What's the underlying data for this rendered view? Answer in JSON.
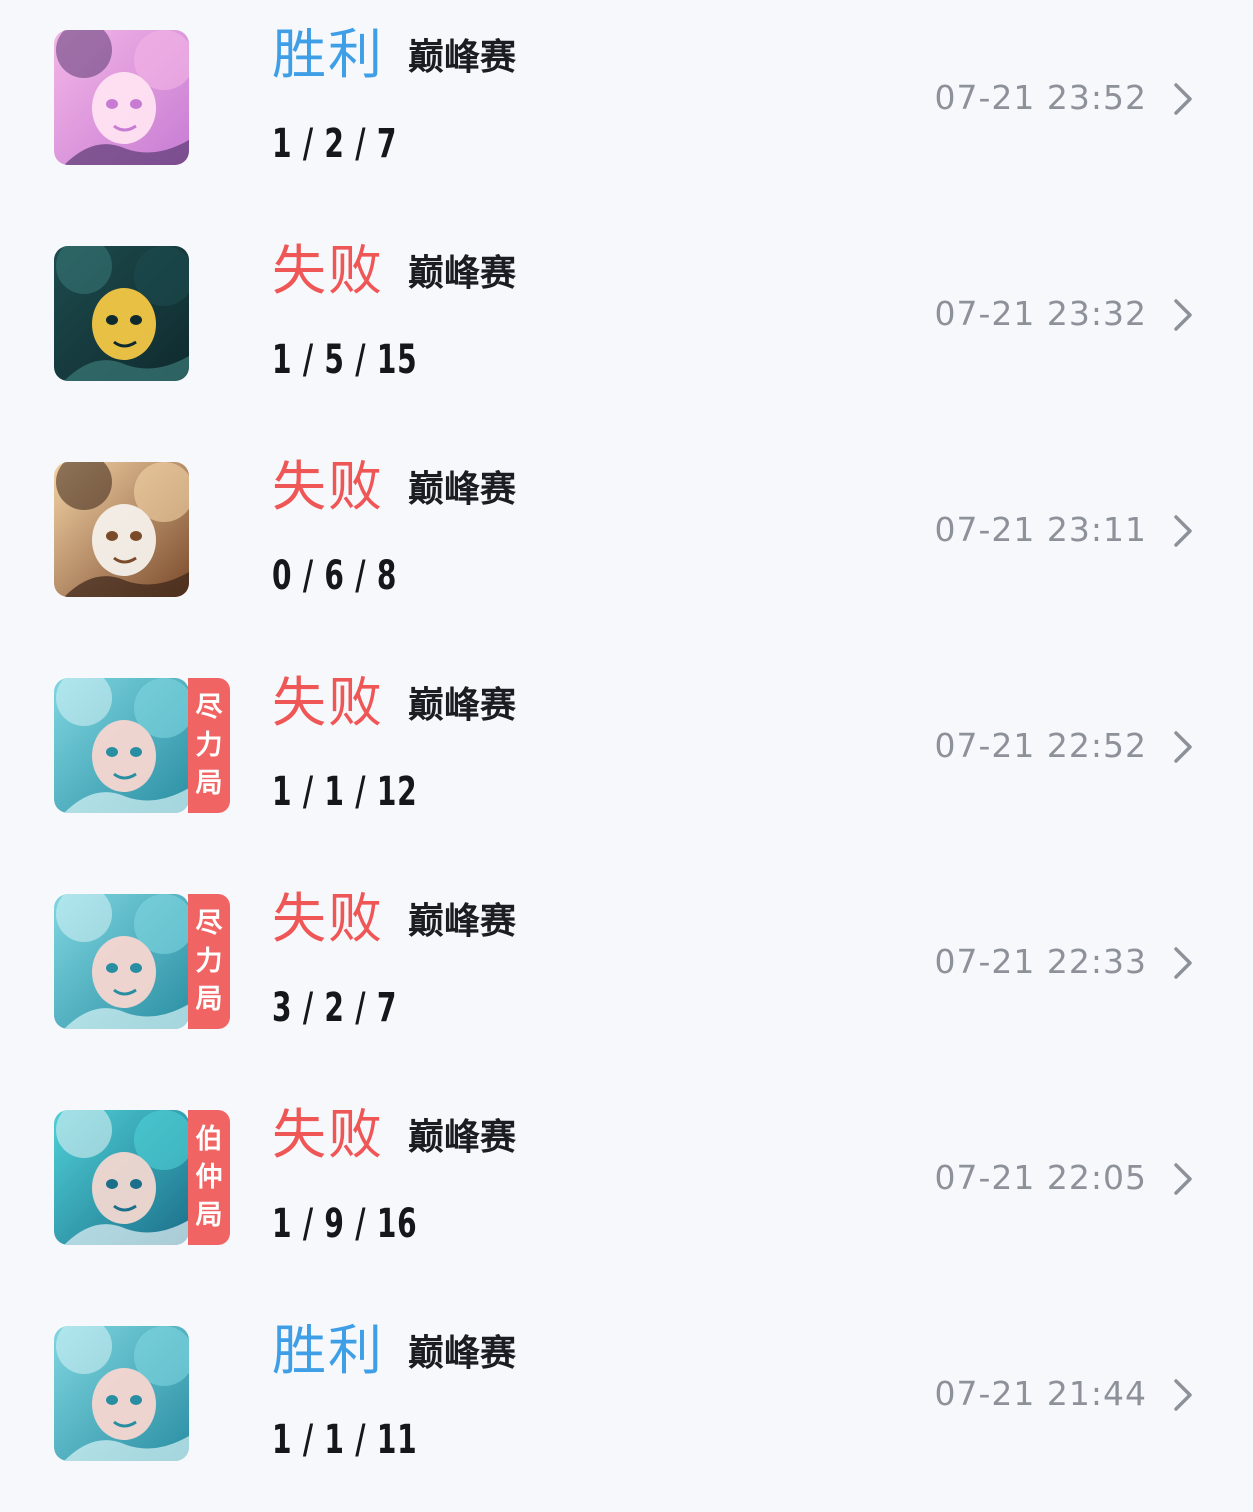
{
  "matches": [
    {
      "result": "胜利",
      "result_type": "win",
      "mode": "巅峰赛",
      "kda": "1 / 2 / 7",
      "time": "07-21 23:52",
      "badge": [],
      "hero_palette": "pink"
    },
    {
      "result": "失败",
      "result_type": "lose",
      "mode": "巅峰赛",
      "kda": "1 / 5 / 15",
      "time": "07-21 23:32",
      "badge": [],
      "hero_palette": "dark-teal"
    },
    {
      "result": "失败",
      "result_type": "lose",
      "mode": "巅峰赛",
      "kda": "0 / 6 / 8",
      "time": "07-21 23:11",
      "badge": [],
      "hero_palette": "warm"
    },
    {
      "result": "失败",
      "result_type": "lose",
      "mode": "巅峰赛",
      "kda": "1 / 1 / 12",
      "time": "07-21 22:52",
      "badge": [
        "尽",
        "力",
        "局"
      ],
      "hero_palette": "aqua"
    },
    {
      "result": "失败",
      "result_type": "lose",
      "mode": "巅峰赛",
      "kda": "3 / 2 / 7",
      "time": "07-21 22:33",
      "badge": [
        "尽",
        "力",
        "局"
      ],
      "hero_palette": "aqua"
    },
    {
      "result": "失败",
      "result_type": "lose",
      "mode": "巅峰赛",
      "kda": "1 / 9 / 16",
      "time": "07-21 22:05",
      "badge": [
        "伯",
        "仲",
        "局"
      ],
      "hero_palette": "cyan"
    },
    {
      "result": "胜利",
      "result_type": "win",
      "mode": "巅峰赛",
      "kda": "1 / 1 / 11",
      "time": "07-21 21:44",
      "badge": [],
      "hero_palette": "aqua"
    }
  ],
  "colors": {
    "win": "#3f9fe6",
    "lose": "#ef5757",
    "badge": "#f06464",
    "time": "#8d9199",
    "background": "#f7f8fc"
  },
  "icons": {
    "row_arrow": "chevron-right-icon"
  }
}
